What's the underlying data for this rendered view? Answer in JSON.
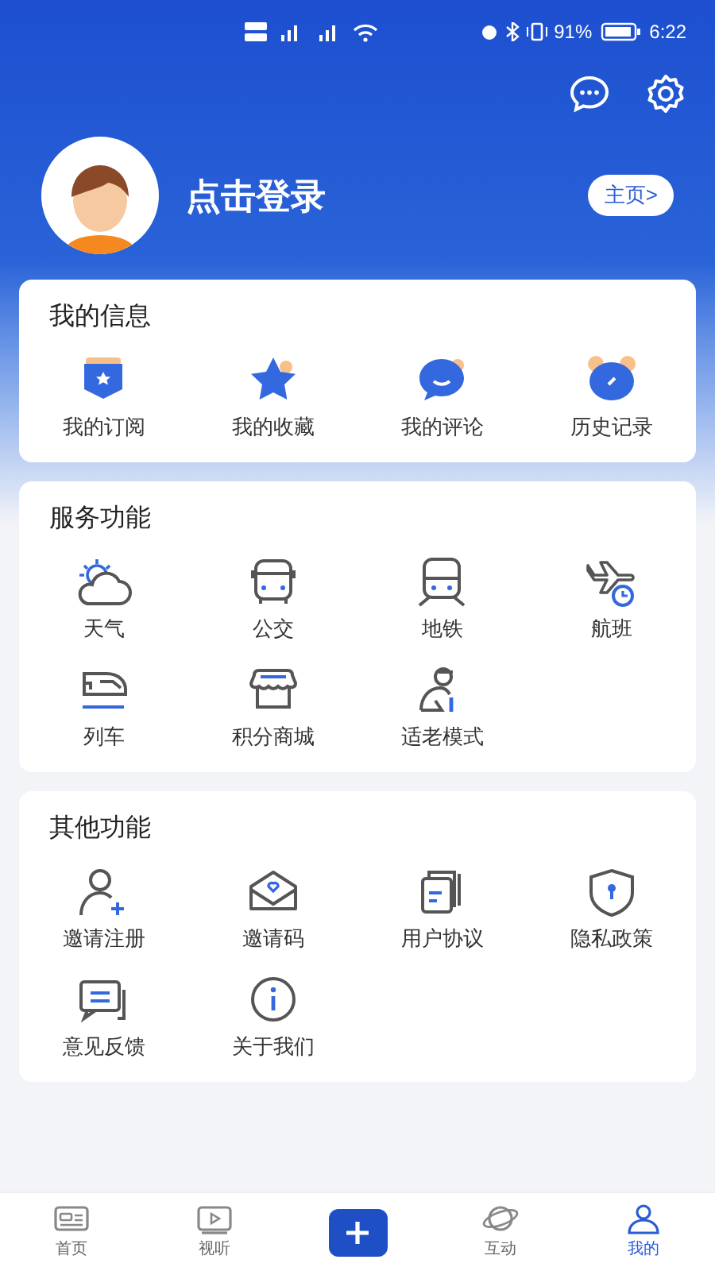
{
  "status_bar": {
    "battery": "91%",
    "time": "6:22"
  },
  "profile": {
    "login": "点击登录",
    "home_button": "主页>"
  },
  "sections": [
    {
      "title": "我的信息",
      "items": [
        "我的订阅",
        "我的收藏",
        "我的评论",
        "历史记录"
      ]
    },
    {
      "title": "服务功能",
      "items": [
        "天气",
        "公交",
        "地铁",
        "航班",
        "列车",
        "积分商城",
        "适老模式"
      ]
    },
    {
      "title": "其他功能",
      "items": [
        "邀请注册",
        "邀请码",
        "用户协议",
        "隐私政策",
        "意见反馈",
        "关于我们"
      ]
    }
  ],
  "tab_bar": [
    {
      "label": "首页",
      "selected": false
    },
    {
      "label": "视听",
      "selected": false
    },
    {
      "kind": "add"
    },
    {
      "label": "互动",
      "selected": false
    },
    {
      "label": "我的",
      "selected": true
    }
  ]
}
